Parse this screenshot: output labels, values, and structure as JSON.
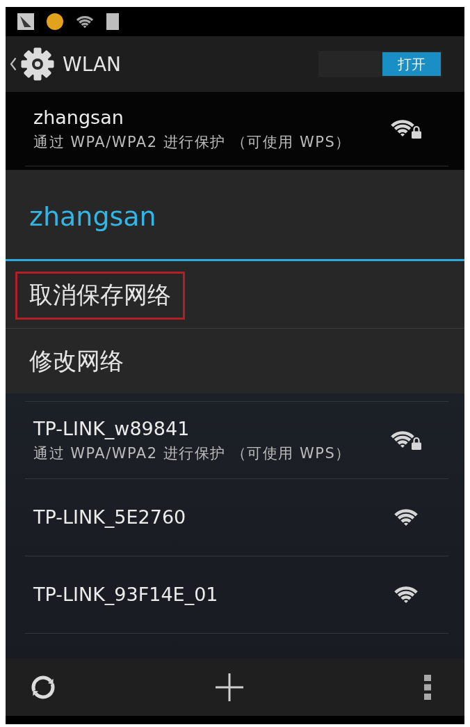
{
  "action_bar": {
    "title": "WLAN",
    "switch": {
      "label": "打开",
      "on": true
    }
  },
  "saved_network": {
    "name": "zhangsan",
    "security": "通过 WPA/WPA2 进行保护 （可使用 WPS）",
    "secured": true
  },
  "dialog": {
    "title": "zhangsan",
    "items": [
      {
        "label": "取消保存网络",
        "highlighted": true
      },
      {
        "label": "修改网络",
        "highlighted": false
      }
    ]
  },
  "networks": [
    {
      "name": "TP-LINK_w89841",
      "security": "通过 WPA/WPA2 进行保护 （可使用 WPS）",
      "secured": true
    },
    {
      "name": "TP-LINK_5E2760",
      "secured": false
    },
    {
      "name": "TP-LINK_93F14E_01",
      "secured": false
    }
  ]
}
